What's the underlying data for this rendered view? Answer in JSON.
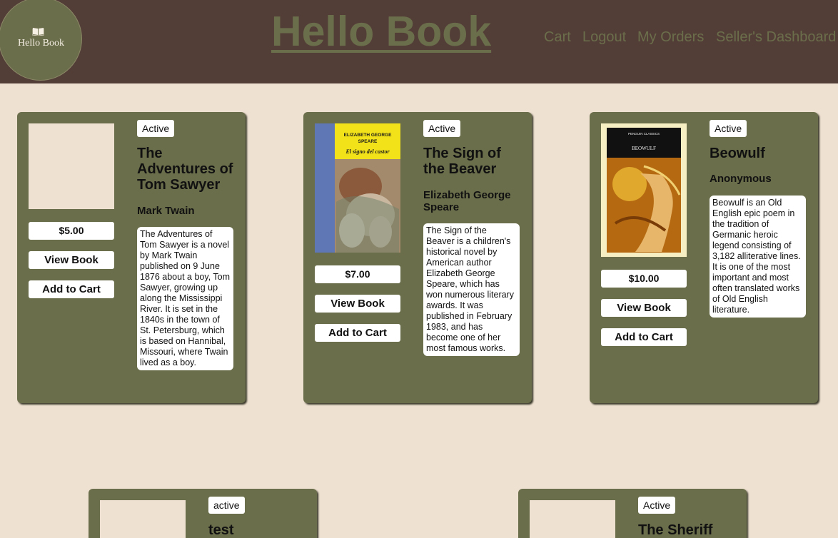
{
  "header": {
    "logo_text": "Hello Book",
    "logo_icon": "open-book-icon",
    "site_title": "Hello Book",
    "nav": [
      "Cart",
      "Logout",
      "My Orders",
      "Seller's Dashboard"
    ]
  },
  "colors": {
    "header_bg": "#533e37",
    "page_bg": "#efe1d1",
    "card_bg": "#6b6e4b",
    "accent_olive": "#6b6e4b"
  },
  "books": [
    {
      "status": "Active",
      "title": "The Adventures of Tom Sawyer",
      "author": "Mark Twain",
      "price": "$5.00",
      "description": "The Adventures of Tom Sawyer is a novel by Mark Twain published on 9 June 1876 about a boy, Tom Sawyer, growing up along the Mississippi River. It is set in the 1840s in the town of St. Petersburg, which is based on Hannibal, Missouri, where Twain lived as a boy.",
      "view_label": "View Book",
      "cart_label": "Add to Cart"
    },
    {
      "status": "Active",
      "title": "The Sign of the Beaver",
      "author": "Elizabeth George Speare",
      "price": "$7.00",
      "description": "The Sign of the Beaver is a children's historical novel by American author Elizabeth George Speare, which has won numerous literary awards. It was published in February 1983, and has become one of her most famous works.",
      "cover_line1": "ELIZABETH GEORGE",
      "cover_line2": "SPEARE",
      "cover_title": "El signo del castor",
      "view_label": "View Book",
      "cart_label": "Add to Cart"
    },
    {
      "status": "Active",
      "title": "Beowulf",
      "author": "Anonymous",
      "price": "$10.00",
      "description": "Beowulf is an Old English epic poem in the tradition of Germanic heroic legend consisting of 3,182 alliterative lines. It is one of the most important and most often translated works of Old English literature.",
      "cover_series": "PENGUIN CLASSICS",
      "cover_title": "BEOWULF",
      "view_label": "View Book",
      "cart_label": "Add to Cart"
    },
    {
      "status": "active",
      "title": "test"
    },
    {
      "status": "Active",
      "title": "The Sheriff"
    }
  ]
}
